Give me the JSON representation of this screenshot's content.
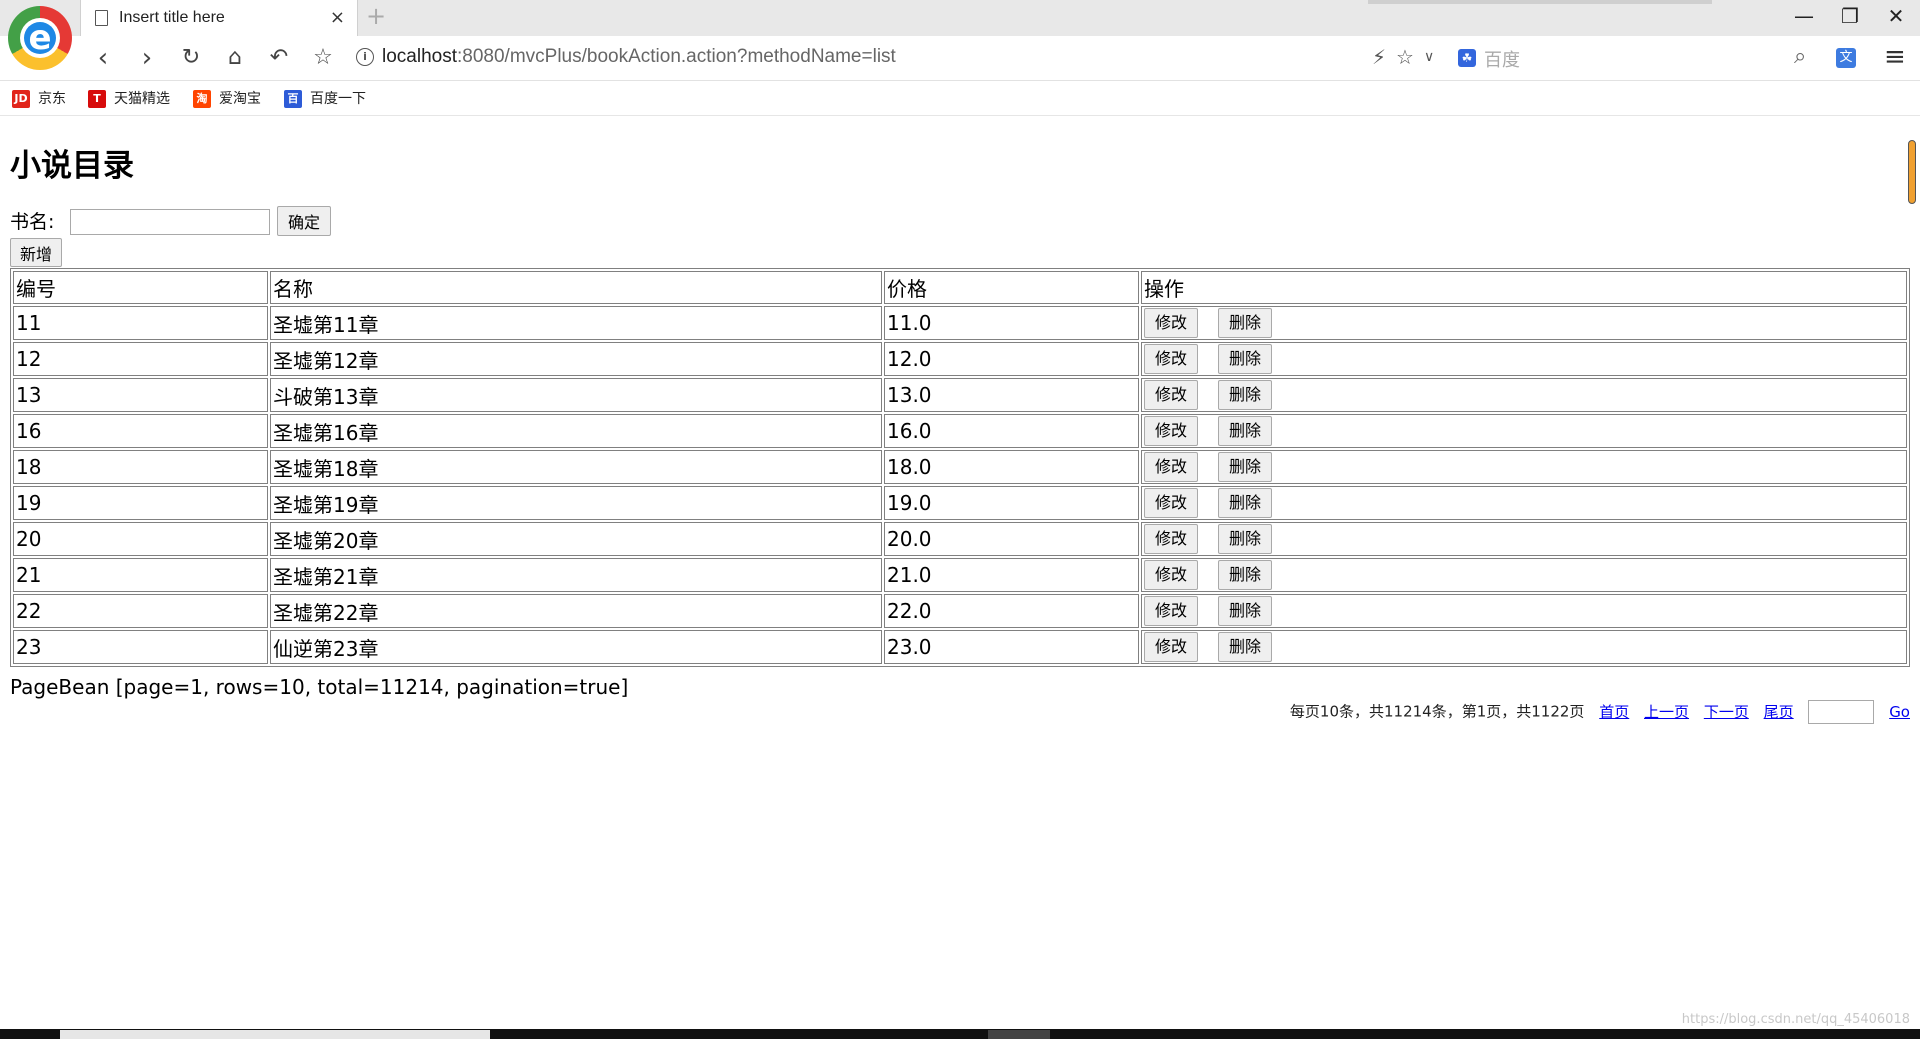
{
  "browser": {
    "logo_letter": "e",
    "tab_title": "Insert title here",
    "tab_close": "×",
    "new_tab": "+",
    "window_controls": [
      "—",
      "❐",
      "✕"
    ],
    "url_host": "localhost",
    "url_path": ":8080/mvcPlus/bookAction.action?methodName=list",
    "search_engine_placeholder": "百度",
    "bookmarks": [
      {
        "icon": "jd-icon",
        "badge": "JD",
        "label": "京东",
        "color": "#e1251b"
      },
      {
        "icon": "tmall-icon",
        "badge": "T",
        "label": "天猫精选",
        "color": "#d70b0b"
      },
      {
        "icon": "taobao-icon",
        "badge": "淘",
        "label": "爱淘宝",
        "color": "#ff4400"
      },
      {
        "icon": "baidu-icon",
        "badge": "百",
        "label": "百度一下",
        "color": "#2d5bd7"
      }
    ]
  },
  "page": {
    "title": "小说目录",
    "search_label": "书名:",
    "search_value": "",
    "confirm_label": "确定",
    "add_label": "新增",
    "table": {
      "headers": [
        "编号",
        "名称",
        "价格",
        "操作"
      ],
      "rows": [
        {
          "id": "11",
          "name": "圣墟第11章",
          "price": "11.0"
        },
        {
          "id": "12",
          "name": "圣墟第12章",
          "price": "12.0"
        },
        {
          "id": "13",
          "name": "斗破第13章",
          "price": "13.0"
        },
        {
          "id": "16",
          "name": "圣墟第16章",
          "price": "16.0"
        },
        {
          "id": "18",
          "name": "圣墟第18章",
          "price": "18.0"
        },
        {
          "id": "19",
          "name": "圣墟第19章",
          "price": "19.0"
        },
        {
          "id": "20",
          "name": "圣墟第20章",
          "price": "20.0"
        },
        {
          "id": "21",
          "name": "圣墟第21章",
          "price": "21.0"
        },
        {
          "id": "22",
          "name": "圣墟第22章",
          "price": "22.0"
        },
        {
          "id": "23",
          "name": "仙逆第23章",
          "price": "23.0"
        }
      ],
      "edit_label": "修改",
      "delete_label": "删除"
    },
    "pagebean_text": "PageBean [page=1, rows=10, total=11214, pagination=true]",
    "pager": {
      "summary": "每页10条，共11214条，第1页，共1122页",
      "first": "首页",
      "prev": "上一页",
      "next": "下一页",
      "last": "尾页",
      "go": "Go"
    }
  },
  "watermark": "https://blog.csdn.net/qq_45406018"
}
